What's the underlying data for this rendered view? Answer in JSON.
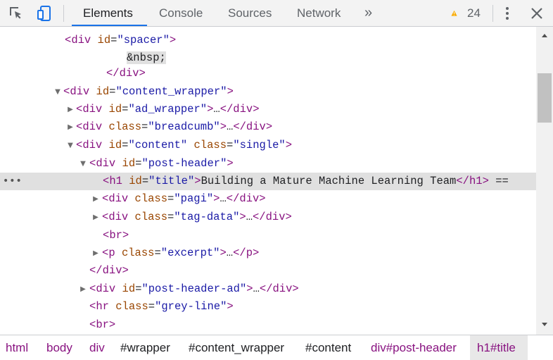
{
  "toolbar": {
    "tabs": [
      "Elements",
      "Console",
      "Sources",
      "Network"
    ],
    "overflow": "»",
    "warning_count": "24"
  },
  "code_lines": [
    {
      "open": "<",
      "tag": "div",
      "a1": "id",
      "v1": "\"spacer\"",
      "close": ">"
    },
    {
      "entity": "&nbsp;"
    },
    {
      "close_tag": "</div>"
    },
    {
      "open": "<",
      "tag": "div",
      "a1": "id",
      "v1": "\"content_wrapper\"",
      "close": ">"
    },
    {
      "open": "<",
      "tag": "div",
      "a1": "id",
      "v1": "\"ad_wrapper\"",
      "close": ">",
      "ell": "…",
      "end": "</div>"
    },
    {
      "open": "<",
      "tag": "div",
      "a1": "class",
      "v1": "\"breadcumb\"",
      "close": ">",
      "ell": "…",
      "end": "</div>"
    },
    {
      "open": "<",
      "tag": "div",
      "a1": "id",
      "v1": "\"content\"",
      "a2": "class",
      "v2": "\"single\"",
      "close": ">"
    },
    {
      "open": "<",
      "tag": "div",
      "a1": "id",
      "v1": "\"post-header\"",
      "close": ">"
    },
    {
      "open": "<",
      "tag": "h1",
      "a1": "id",
      "v1": "\"title\"",
      "close": ">",
      "text": "Building a Mature Machine Learning Team",
      "end": "</h1>",
      "suffix": "==",
      "dots": "•••"
    },
    {
      "open": "<",
      "tag": "div",
      "a1": "class",
      "v1": "\"pagi\"",
      "close": ">",
      "ell": "…",
      "end": "</div>"
    },
    {
      "open": "<",
      "tag": "div",
      "a1": "class",
      "v1": "\"tag-data\"",
      "close": ">",
      "ell": "…",
      "end": "</div>"
    },
    {
      "open": "<",
      "tag": "br",
      "close": ">"
    },
    {
      "open": "<",
      "tag": "p",
      "a1": "class",
      "v1": "\"excerpt\"",
      "close": ">",
      "ell": "…",
      "end": "</p>"
    },
    {
      "close_tag": "</div>"
    },
    {
      "open": "<",
      "tag": "div",
      "a1": "id",
      "v1": "\"post-header-ad\"",
      "close": ">",
      "ell": "…",
      "end": "</div>"
    },
    {
      "open": "<",
      "tag": "hr",
      "a1": "class",
      "v1": "\"grey-line\"",
      "close": ">"
    },
    {
      "open": "<",
      "tag": "br",
      "close": ">"
    }
  ],
  "breadcrumbs": [
    "html",
    "body",
    "div",
    "#wrapper",
    "#content_wrapper",
    "#content",
    "div#post-header",
    "h1#title"
  ],
  "colors": {
    "tag": "#881280",
    "attr": "#994500",
    "value": "#1a1aa6",
    "accent": "#1a73e8",
    "warning": "#f9ab00"
  }
}
